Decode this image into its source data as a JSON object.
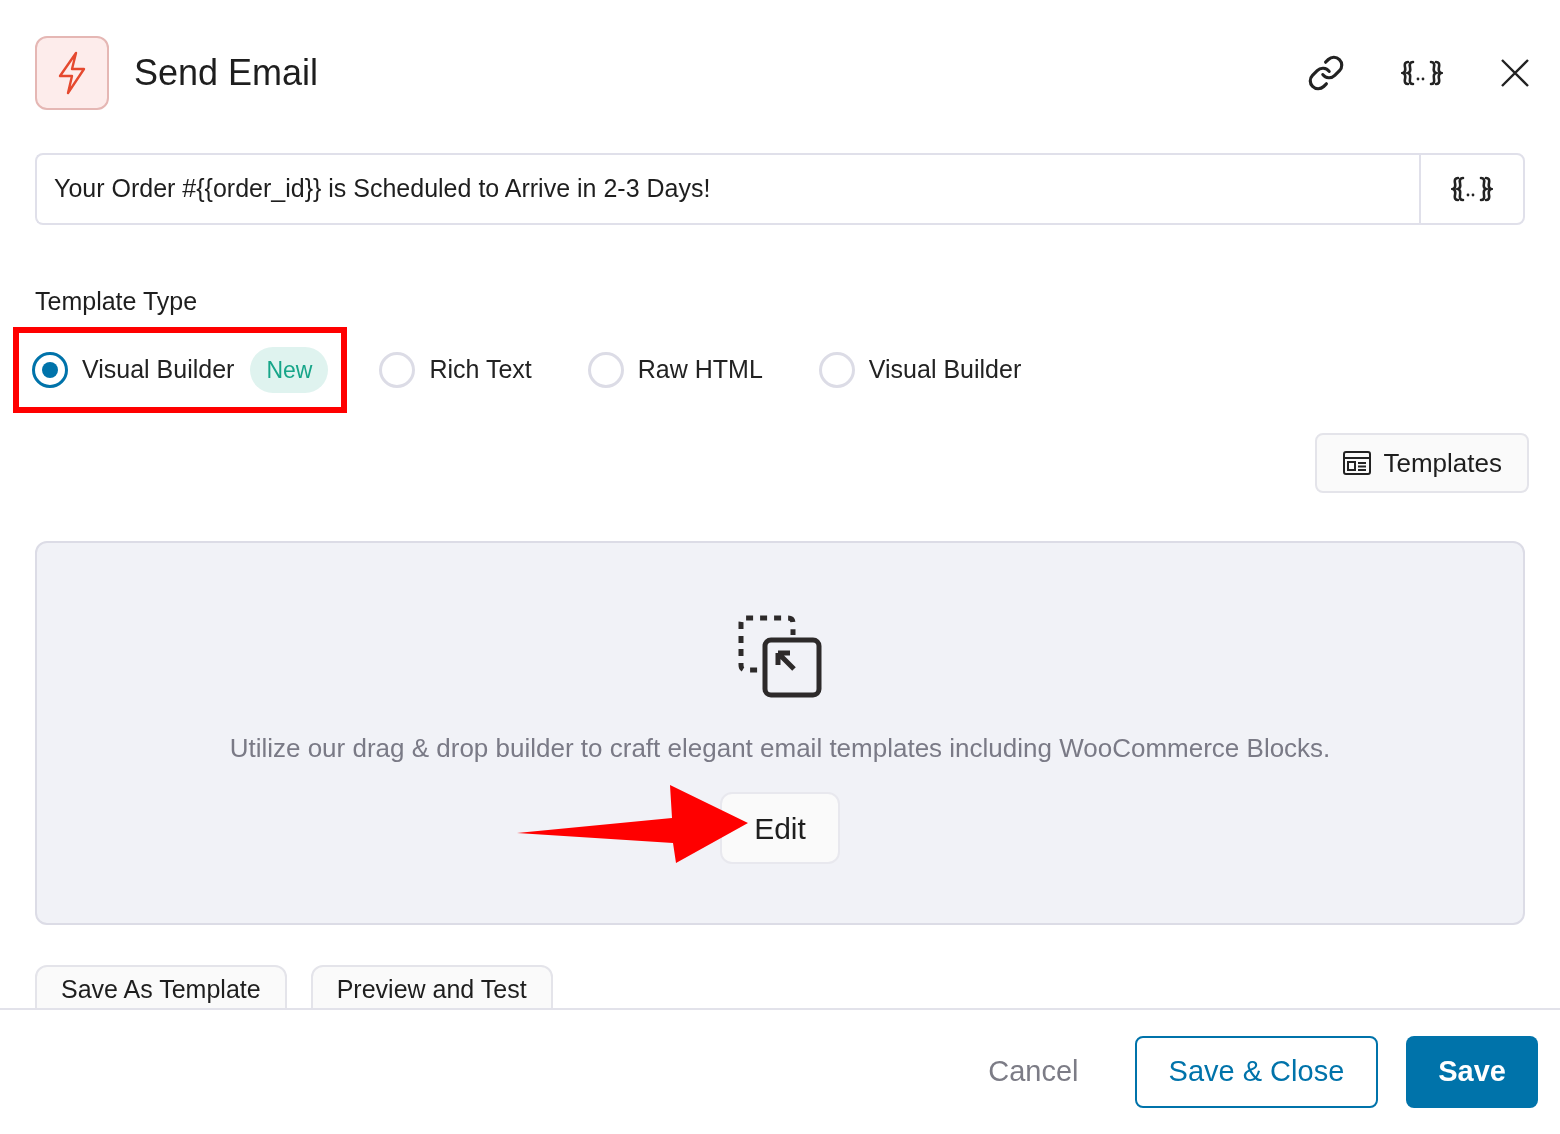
{
  "header": {
    "title": "Send Email"
  },
  "subject": {
    "value": "Your Order #{{order_id}} is Scheduled to Arrive in 2-3 Days!"
  },
  "template_type": {
    "label": "Template Type",
    "options": [
      {
        "label": "Visual Builder",
        "badge": "New",
        "selected": true,
        "highlighted": true
      },
      {
        "label": "Rich Text",
        "selected": false,
        "highlighted": false
      },
      {
        "label": "Raw HTML",
        "selected": false,
        "highlighted": false
      },
      {
        "label": "Visual Builder",
        "selected": false,
        "highlighted": false
      }
    ]
  },
  "templates_button": "Templates",
  "builder": {
    "description": "Utilize our drag & drop builder to craft elegant email templates including WooCommerce Blocks.",
    "edit_button": "Edit"
  },
  "secondary_buttons": [
    "Save As Template",
    "Preview and Test"
  ],
  "footer": {
    "cancel": "Cancel",
    "save_close": "Save & Close",
    "save": "Save"
  }
}
